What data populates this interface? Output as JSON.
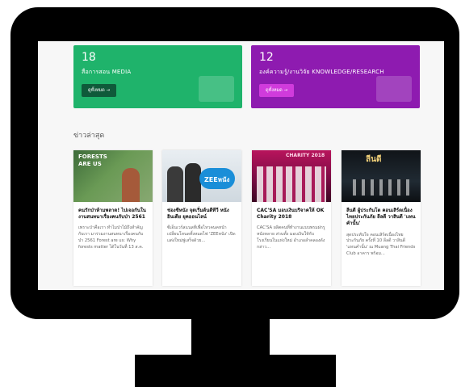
{
  "stats": [
    {
      "number": "18",
      "label": "สื่อการสอน MEDIA",
      "button": "ดูทั้งหมด →"
    },
    {
      "number": "12",
      "label": "องค์ความรู้/งานวิจัย KNOWLEDGE/RESEARCH",
      "button": "ดูทั้งหมด →"
    }
  ],
  "news_section": {
    "title": "ข่าวล่าสุด",
    "items": [
      {
        "image_text": "FORESTS ARE US",
        "title": "คนรักป่าห้ามพลาด! ไปเจอกันในงานสนทนาเรื่องคนกับป่า 2561",
        "excerpt": "เพราะป่าคือเรา ทำไมป่าไม้ถึงสำคัญกับเรา มาร่วมงานสนทนาเรื่องคนกับป่า 2561 Forest are us: Why forests matter ได้ในวันที่ 13 ส.ค."
      },
      {
        "image_text": "ZEEหนัง",
        "title": "ช่องซีหนัง จุดเริ่มต้นดีทีวี หนังอินเดีย ยุคออนไลน์",
        "excerpt": "ซีเอ็นเวร์สแนลทีเพื่อไหวคนคหน้าเปลี่ยนโหนดทั้งหมดไฟ 'ZEEหนัง' เปิดแต่งใหม่ฟูเสร็จด้วย..."
      },
      {
        "image_text": "CHARITY 2018",
        "title": "CAC'SA มอบเงินบริจาคให้ OK Charity 2018",
        "excerpt": "CAC'SA ผลิตคนที่ทำงานแบบพรมฝกรูหนังหลาย ส่วนทั้ง มอบเงินให้กับโรงเรียนในแห่งใหม่ อำเภอลำคลองดังกล่าว..."
      },
      {
        "image_text": "ลีนดี",
        "title": "ลีนดี ผู้ประกันโต คอนเสิร์ตเนื่องไทยประกันภัย ลีลดี วาสินดี 'แทนคำนั้น'",
        "excerpt": "สุดประทับใจ คอนเสิร์ตเนื่องไทยประกันภัย ครั้งที่ 10 ลีลดี วาสินดี 'แทนคำนั้น' ณ Muang Thai Friends Club อาคาร พร้อม..."
      }
    ]
  },
  "colors": {
    "media": "#1fb36b",
    "knowledge": "#8e1bb0",
    "bezel": "#000000"
  }
}
